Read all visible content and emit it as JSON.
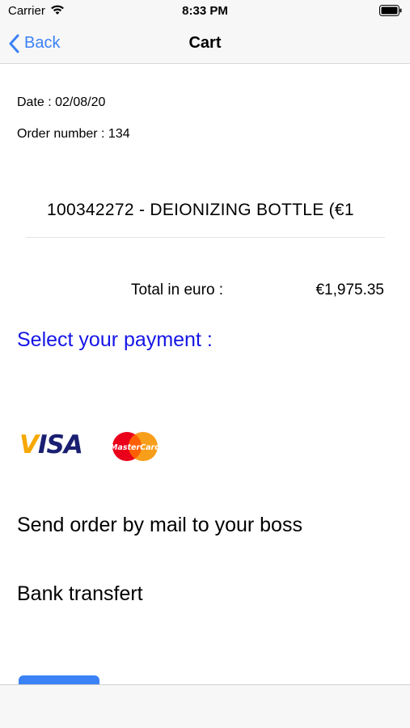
{
  "status_bar": {
    "carrier": "Carrier",
    "time": "8:33 PM",
    "icons": [
      "wifi-icon",
      "battery-icon"
    ]
  },
  "nav_bar": {
    "back_label": "Back",
    "title": "Cart",
    "accent_color": "#3b82f6"
  },
  "order": {
    "date_text": "Date : 02/08/20",
    "number_text": "Order number : 134"
  },
  "cart": {
    "items": [
      {
        "label": "100342272 - DEIONIZING BOTTLE (€1"
      }
    ],
    "total_label": "Total in euro :",
    "total_value": "€1,975.35"
  },
  "payment": {
    "title": "Select your payment :",
    "title_color": "#1515e6",
    "cards": [
      {
        "name": "VISA",
        "icon": "visa-logo"
      },
      {
        "name": "MasterCard",
        "icon": "mastercard-logo"
      }
    ],
    "options": {
      "mail_boss": "Send order by mail to your boss",
      "bank_transfer": "Bank transfert"
    }
  }
}
